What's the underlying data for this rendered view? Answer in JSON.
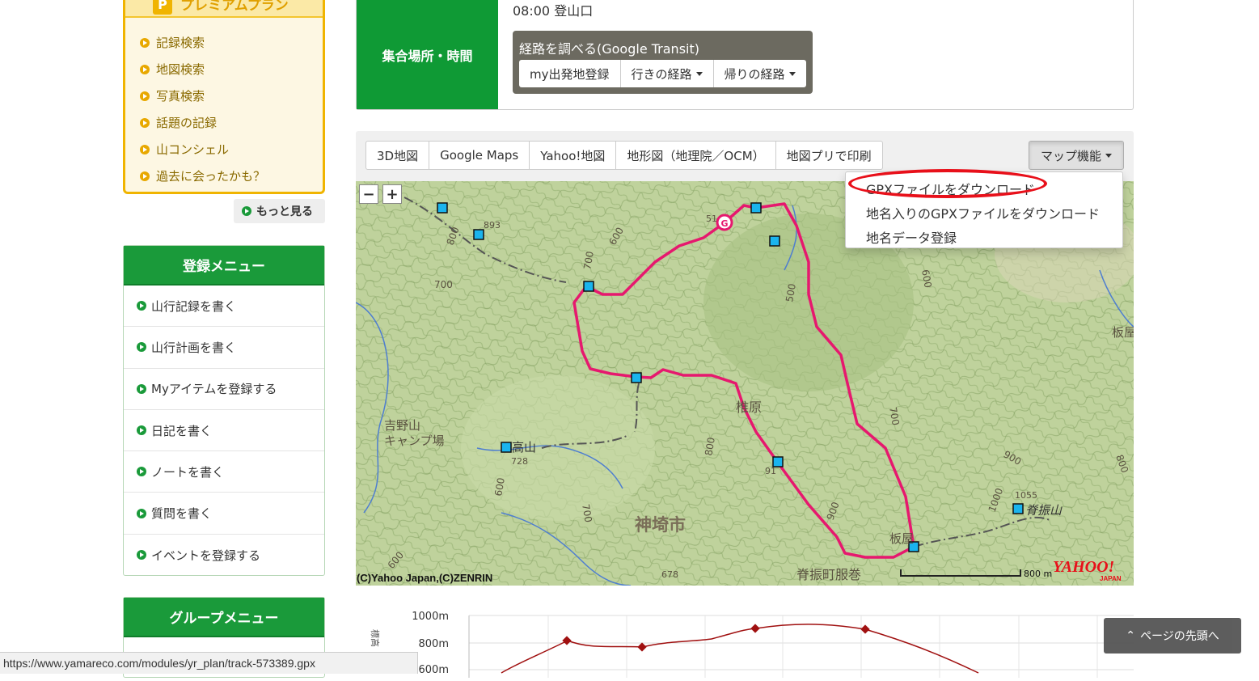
{
  "premium": {
    "title": "プレミアムプラン",
    "badge": "P",
    "items": [
      "記録検索",
      "地図検索",
      "写真検索",
      "話題の記録",
      "山コンシェル",
      "過去に会ったかも？"
    ],
    "more": "もっと見る"
  },
  "reg_menu": {
    "title": "登録メニュー",
    "items": [
      "山行記録を書く",
      "山行計画を書く",
      "Myアイテムを登録する",
      "日記を書く",
      "ノートを書く",
      "質問を書く",
      "イベントを登録する"
    ]
  },
  "group_menu": {
    "title": "グループメニュー"
  },
  "meeting": {
    "label": "集合場所・時間",
    "time": "08:00 登山口",
    "transit_title": "経路を調べる(Google Transit)",
    "buttons": [
      "my出発地登録",
      "行きの経路",
      "帰りの経路"
    ]
  },
  "map": {
    "tabs": [
      "3D地図",
      "Google Maps",
      "Yahoo!地図",
      "地形図（地理院／OCM）",
      "地図プリで印刷"
    ],
    "function_button": "マップ機能",
    "zoom_out": "−",
    "zoom_in": "+",
    "dropdown": [
      "GPXファイルをダウンロード",
      "地名入りのGPXファイルをダウンロード",
      "地名データ登録"
    ],
    "labels": {
      "city": "神埼市",
      "shiihara": "椎原",
      "sefuri_san": "脊振山",
      "takayama": "高山",
      "yoshinoyama": "吉野山",
      "camp": "キャンプ場",
      "sefuri_office": "脊振町服巻",
      "itaya": "板屋",
      "itaya_right": "板屋",
      "start_mark": "G"
    },
    "spot_heights": [
      "893",
      "728",
      "1055",
      "678",
      "91",
      "51"
    ],
    "contours": [
      "800",
      "700",
      "600",
      "500",
      "900",
      "1000"
    ],
    "copyright": "(C)Yahoo Japan,(C)ZENRIN",
    "scale": "800 m",
    "yahoo_logo": "YAHOO!",
    "yahoo_sub": "JAPAN"
  },
  "elevation": {
    "y_labels": [
      "1000m",
      "800m",
      "600m"
    ],
    "axis_title": "標高"
  },
  "page_top": "ページの先頭へ",
  "status_url": "https://www.yamareco.com/modules/yr_plan/track-573389.gpx"
}
